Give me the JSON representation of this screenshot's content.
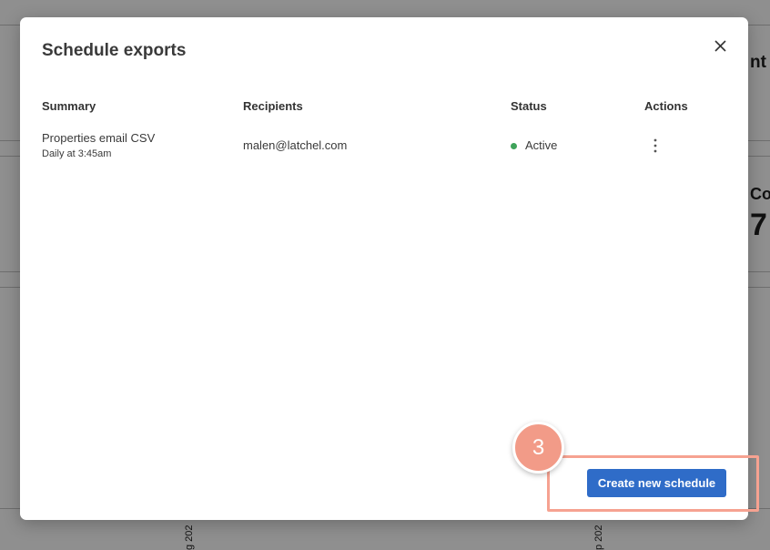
{
  "background": {
    "heading_fragment": "nt F",
    "card_label_fragment": "Co",
    "card_value_fragment": "7",
    "axis_label_1": "g 202",
    "axis_label_2": "p 202"
  },
  "modal": {
    "title": "Schedule exports",
    "close_icon": "close-icon",
    "columns": {
      "summary": "Summary",
      "recipients": "Recipients",
      "status": "Status",
      "actions": "Actions"
    },
    "rows": [
      {
        "summary": "Properties email CSV",
        "frequency": "Daily at 3:45am",
        "recipients": "malen@latchel.com",
        "status": "Active",
        "status_color": "#3fa35a",
        "actions_icon": "more-vertical-icon"
      }
    ],
    "create_button_label": "Create new schedule"
  },
  "annotation": {
    "step_number": "3",
    "highlight_color": "#f6a291"
  },
  "colors": {
    "accent": "#2f6cc8",
    "overlay": "#8f8f8f"
  }
}
